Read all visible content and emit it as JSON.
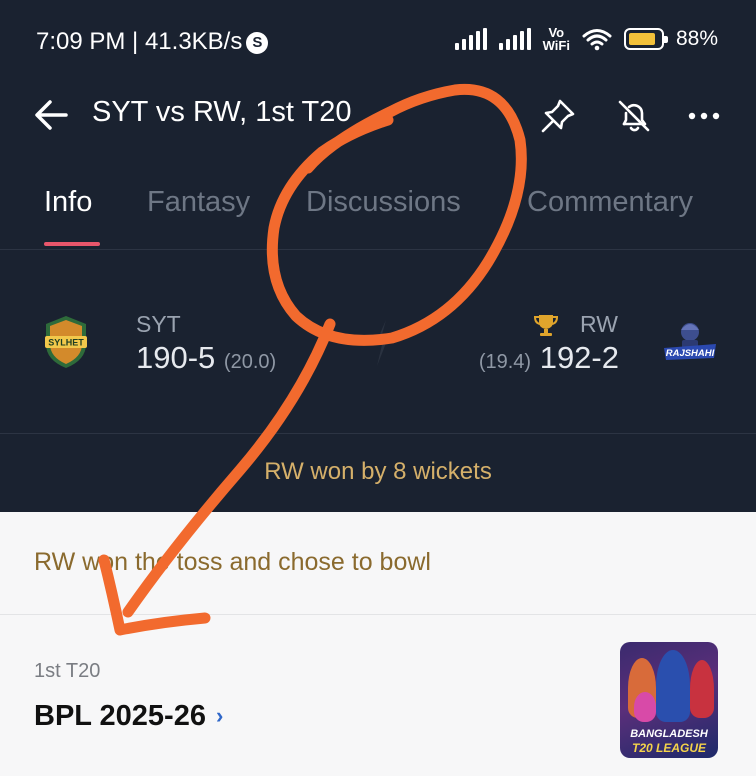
{
  "status_bar": {
    "time": "7:09 PM | 41.3KB/s",
    "s_icon": "S",
    "vowifi_1": "Vo",
    "vowifi_2": "WiFi",
    "battery_percent": "88%",
    "battery_level": 0.88,
    "icons": [
      "signal-icon",
      "signal-icon",
      "wifi-icon",
      "battery-icon"
    ]
  },
  "header": {
    "title": "SYT vs RW, 1st T20",
    "icons": [
      "back-arrow-icon",
      "pin-icon",
      "bell-off-icon",
      "more-options-icon"
    ]
  },
  "tabs": [
    {
      "label": "Info",
      "active": true
    },
    {
      "label": "Fantasy",
      "active": false
    },
    {
      "label": "Discussions",
      "active": false
    },
    {
      "label": "Commentary",
      "active": false
    }
  ],
  "match": {
    "team1": {
      "name": "SYT",
      "score": "190-5",
      "overs": "(20.0)",
      "logo_text": "SYLHET"
    },
    "team2": {
      "name": "RW",
      "score": "192-2",
      "overs": "(19.4)",
      "logo_text": "RAJSHAHI",
      "winner_icon": "trophy-icon"
    },
    "result": "RW won by 8 wickets"
  },
  "toss": "RW won the toss and chose to bowl",
  "series_card": {
    "match_no": "1st T20",
    "series_name": "BPL 2025-26",
    "chevron": "›",
    "thumb_line1": "BANGLADESH",
    "thumb_line2": "T20 LEAGUE"
  },
  "colors": {
    "header_bg": "#1a2230",
    "tab_active_underline": "#e8566b",
    "result_text": "#d5b06a",
    "toss_text": "#8a6a2e",
    "annotation": "#f26a2e"
  }
}
